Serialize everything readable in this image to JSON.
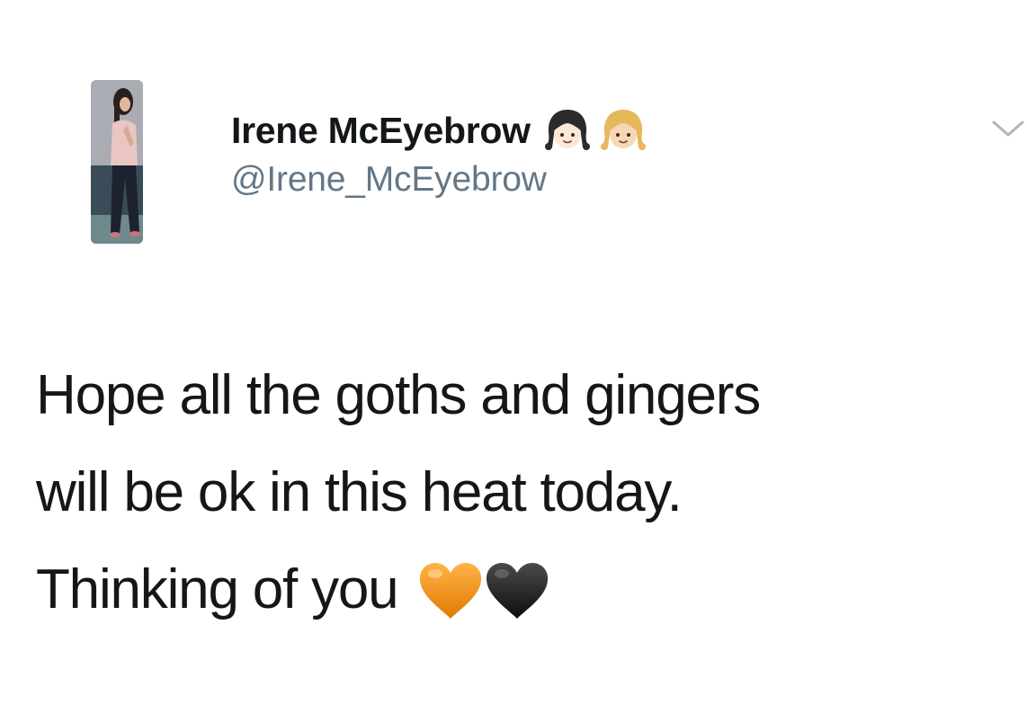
{
  "tweet": {
    "author": {
      "display_name": "Irene McEyebrow",
      "handle": "@Irene_McEyebrow",
      "name_emojis": [
        "girl-dark-hair-emoji-icon",
        "girl-blonde-hair-emoji-icon"
      ]
    },
    "menu_icon": "chevron-down-icon",
    "text_lines": [
      "Hope all the goths and gingers",
      "will be ok in this heat today.",
      "Thinking of you"
    ],
    "trailing_emojis": [
      "orange-heart-icon",
      "black-heart-icon"
    ]
  },
  "colors": {
    "text": "#14171a",
    "handle": "#657786",
    "caret": "#aab8c2",
    "orange_heart": "#f4900c",
    "black_heart": "#1a1a1a"
  }
}
